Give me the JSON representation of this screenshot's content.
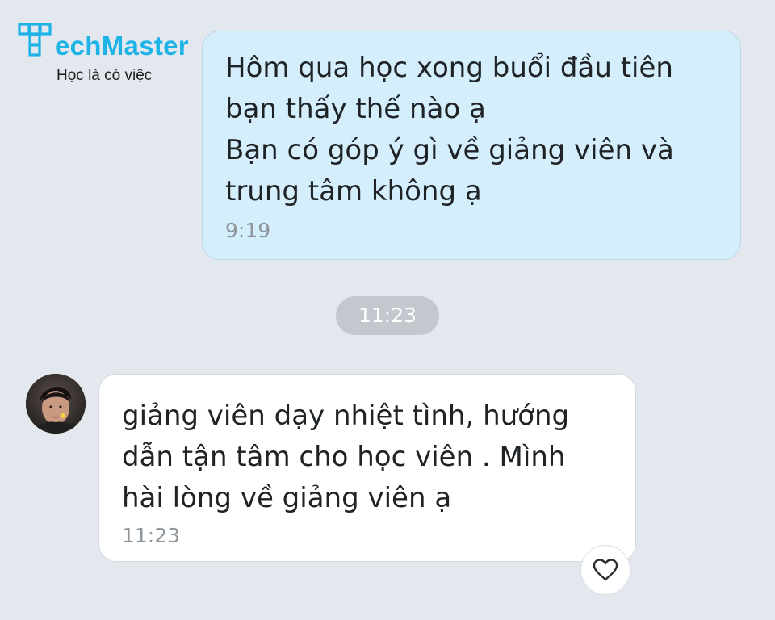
{
  "logo": {
    "wordmark": "echMaster",
    "tagline": "Học là có việc",
    "color": "#1eb3e6"
  },
  "messages": [
    {
      "direction": "outgoing",
      "lines": [
        "Hôm qua học xong buổi đầu tiên",
        "bạn thấy thế nào ạ",
        "Bạn có góp ý gì về giảng viên và",
        "trung tâm không ạ"
      ],
      "time": "9:19",
      "bubble_color": "#d4eefc"
    },
    {
      "direction": "incoming",
      "lines": [
        "giảng viên dạy nhiệt tình, hướng",
        "dẫn tận tâm cho học viên . Mình",
        "hài lòng về giảng viên ạ"
      ],
      "time": "11:23",
      "bubble_color": "#ffffff"
    }
  ],
  "date_separator": "11:23",
  "icons": {
    "reaction": "heart-icon",
    "logo_mark": "techmaster-logo-icon",
    "avatar": "user-avatar"
  },
  "colors": {
    "background": "#e3e8ef",
    "pill": "#c3c8cf",
    "timestamp": "#8e959b"
  }
}
